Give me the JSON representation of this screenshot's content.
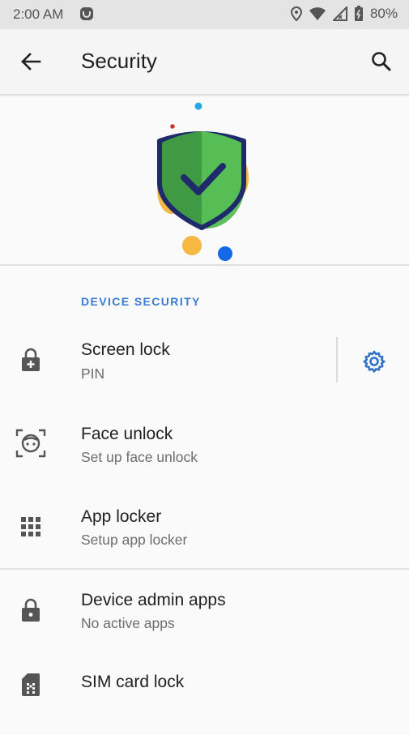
{
  "status_bar": {
    "time": "2:00 AM",
    "battery": "80%",
    "icons": [
      "notification-icon",
      "location-icon",
      "wifi-icon",
      "signal-icon",
      "battery-icon"
    ]
  },
  "app_bar": {
    "title": "Security",
    "back_icon": "arrow-back-icon",
    "search_icon": "search-icon"
  },
  "colors": {
    "accent": "#3a7bd5",
    "gear": "#2f72c9",
    "shield_dark": "#1f2a6b",
    "shield_green": "#3dad4f",
    "shield_green_light": "#5cc05e",
    "blob_yellow": "#f5b843",
    "dot_blue": "#1368e8",
    "dot_cyan": "#2aa6e0",
    "dot_red": "#d32f2f"
  },
  "section": {
    "header": "DEVICE SECURITY"
  },
  "items": [
    {
      "title": "Screen lock",
      "subtitle": "PIN",
      "icon": "lock-add-icon",
      "action_icon": "gear-icon"
    },
    {
      "title": "Face unlock",
      "subtitle": "Set up face unlock",
      "icon": "face-scan-icon"
    },
    {
      "title": "App locker",
      "subtitle": "Setup app locker",
      "icon": "apps-grid-icon"
    },
    {
      "title": "Device admin apps",
      "subtitle": "No active apps",
      "icon": "lock-icon"
    },
    {
      "title": "SIM card lock",
      "subtitle": "",
      "icon": "sim-card-icon"
    }
  ]
}
